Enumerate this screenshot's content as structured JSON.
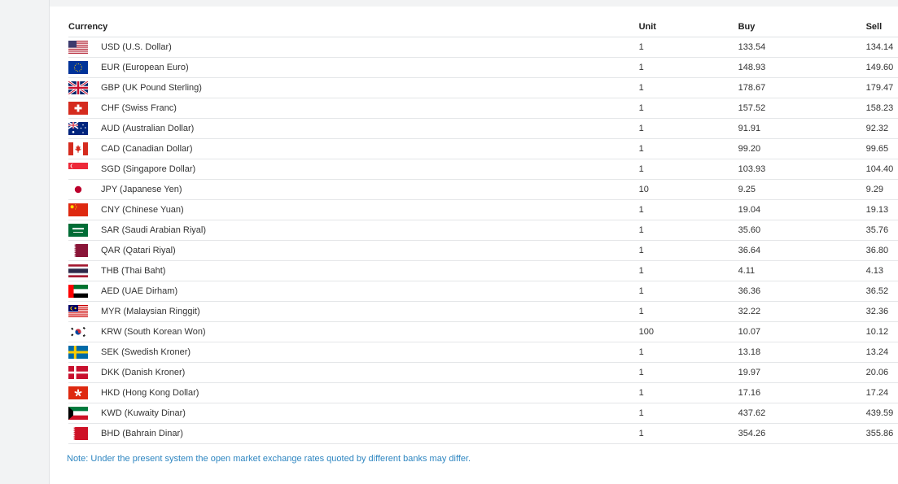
{
  "table": {
    "headers": {
      "currency": "Currency",
      "unit": "Unit",
      "buy": "Buy",
      "sell": "Sell"
    },
    "rows": [
      {
        "flag": "us-flag-icon",
        "currency": "USD (U.S. Dollar)",
        "unit": "1",
        "buy": "133.54",
        "sell": "134.14"
      },
      {
        "flag": "eu-flag-icon",
        "currency": "EUR (European Euro)",
        "unit": "1",
        "buy": "148.93",
        "sell": "149.60"
      },
      {
        "flag": "uk-flag-icon",
        "currency": "GBP (UK Pound Sterling)",
        "unit": "1",
        "buy": "178.67",
        "sell": "179.47"
      },
      {
        "flag": "swiss-flag-icon",
        "currency": "CHF (Swiss Franc)",
        "unit": "1",
        "buy": "157.52",
        "sell": "158.23"
      },
      {
        "flag": "australia-flag-icon",
        "currency": "AUD (Australian Dollar)",
        "unit": "1",
        "buy": "91.91",
        "sell": "92.32"
      },
      {
        "flag": "canada-flag-icon",
        "currency": "CAD (Canadian Dollar)",
        "unit": "1",
        "buy": "99.20",
        "sell": "99.65"
      },
      {
        "flag": "singapore-flag-icon",
        "currency": "SGD (Singapore Dollar)",
        "unit": "1",
        "buy": "103.93",
        "sell": "104.40"
      },
      {
        "flag": "japan-flag-icon",
        "currency": "JPY (Japanese Yen)",
        "unit": "10",
        "buy": "9.25",
        "sell": "9.29"
      },
      {
        "flag": "china-flag-icon",
        "currency": "CNY (Chinese Yuan)",
        "unit": "1",
        "buy": "19.04",
        "sell": "19.13"
      },
      {
        "flag": "saudi-flag-icon",
        "currency": "SAR (Saudi Arabian Riyal)",
        "unit": "1",
        "buy": "35.60",
        "sell": "35.76"
      },
      {
        "flag": "qatar-flag-icon",
        "currency": "QAR (Qatari Riyal)",
        "unit": "1",
        "buy": "36.64",
        "sell": "36.80"
      },
      {
        "flag": "thailand-flag-icon",
        "currency": "THB (Thai Baht)",
        "unit": "1",
        "buy": "4.11",
        "sell": "4.13"
      },
      {
        "flag": "uae-flag-icon",
        "currency": "AED (UAE Dirham)",
        "unit": "1",
        "buy": "36.36",
        "sell": "36.52"
      },
      {
        "flag": "malaysia-flag-icon",
        "currency": "MYR (Malaysian Ringgit)",
        "unit": "1",
        "buy": "32.22",
        "sell": "32.36"
      },
      {
        "flag": "korea-flag-icon",
        "currency": "KRW (South Korean Won)",
        "unit": "100",
        "buy": "10.07",
        "sell": "10.12"
      },
      {
        "flag": "sweden-flag-icon",
        "currency": "SEK (Swedish Kroner)",
        "unit": "1",
        "buy": "13.18",
        "sell": "13.24"
      },
      {
        "flag": "denmark-flag-icon",
        "currency": "DKK (Danish Kroner)",
        "unit": "1",
        "buy": "19.97",
        "sell": "20.06"
      },
      {
        "flag": "hongkong-flag-icon",
        "currency": "HKD (Hong Kong Dollar)",
        "unit": "1",
        "buy": "17.16",
        "sell": "17.24"
      },
      {
        "flag": "kuwait-flag-icon",
        "currency": "KWD (Kuwaity Dinar)",
        "unit": "1",
        "buy": "437.62",
        "sell": "439.59"
      },
      {
        "flag": "bahrain-flag-icon",
        "currency": "BHD (Bahrain Dinar)",
        "unit": "1",
        "buy": "354.26",
        "sell": "355.86"
      }
    ]
  },
  "note": "Note: Under the present system the open market exchange rates quoted by different banks may differ.",
  "colors": {
    "note": "#2e86c1",
    "border": "#e4e6e8"
  }
}
